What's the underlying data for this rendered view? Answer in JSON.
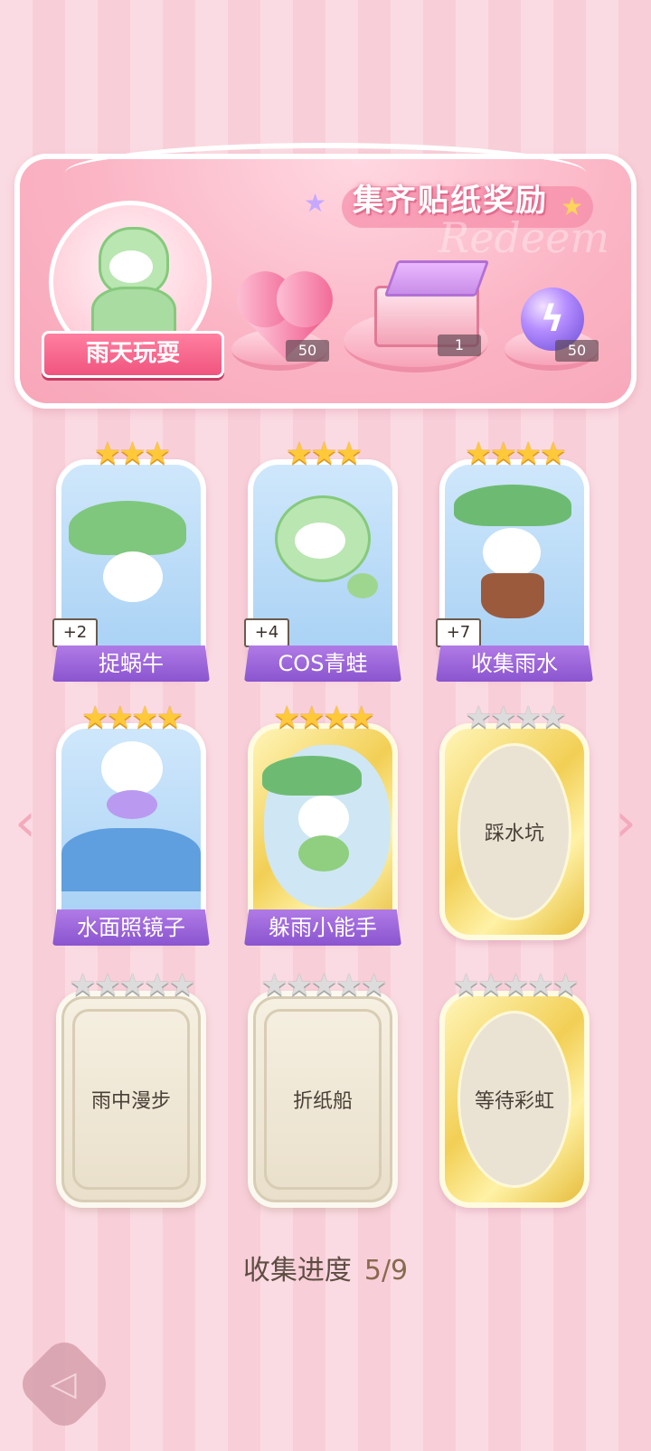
{
  "banner": {
    "title": "集齐贴纸奖励",
    "watermark": "Redeem",
    "theme_label": "雨天玩耍",
    "rewards": [
      {
        "icon": "pink-heart-gem-icon",
        "count": "50"
      },
      {
        "icon": "gift-box-icon",
        "count": "1"
      },
      {
        "icon": "purple-energy-orb-icon",
        "count": "50"
      }
    ]
  },
  "stickers": [
    {
      "name": "捉蜗牛",
      "stars": 3,
      "max_stars": 3,
      "collected": true,
      "plus": "+2"
    },
    {
      "name": "COS青蛙",
      "stars": 3,
      "max_stars": 3,
      "collected": true,
      "plus": "+4"
    },
    {
      "name": "收集雨水",
      "stars": 4,
      "max_stars": 4,
      "collected": true,
      "plus": "+7"
    },
    {
      "name": "水面照镜子",
      "stars": 4,
      "max_stars": 4,
      "collected": true,
      "plus": ""
    },
    {
      "name": "躲雨小能手",
      "stars": 4,
      "max_stars": 4,
      "collected": true,
      "plus": ""
    },
    {
      "name": "踩水坑",
      "stars": 0,
      "max_stars": 4,
      "collected": false,
      "plus": ""
    },
    {
      "name": "雨中漫步",
      "stars": 0,
      "max_stars": 5,
      "collected": false,
      "plus": ""
    },
    {
      "name": "折纸船",
      "stars": 0,
      "max_stars": 5,
      "collected": false,
      "plus": ""
    },
    {
      "name": "等待彩虹",
      "stars": 0,
      "max_stars": 5,
      "collected": false,
      "plus": ""
    }
  ],
  "progress": {
    "label": "收集进度",
    "value": "5/9"
  },
  "nav": {
    "prev": "‹",
    "next": "›"
  },
  "colors": {
    "label_purple": "#8a55cf",
    "star_gold": "#ffc93a",
    "star_grey": "#dcdcdc"
  }
}
